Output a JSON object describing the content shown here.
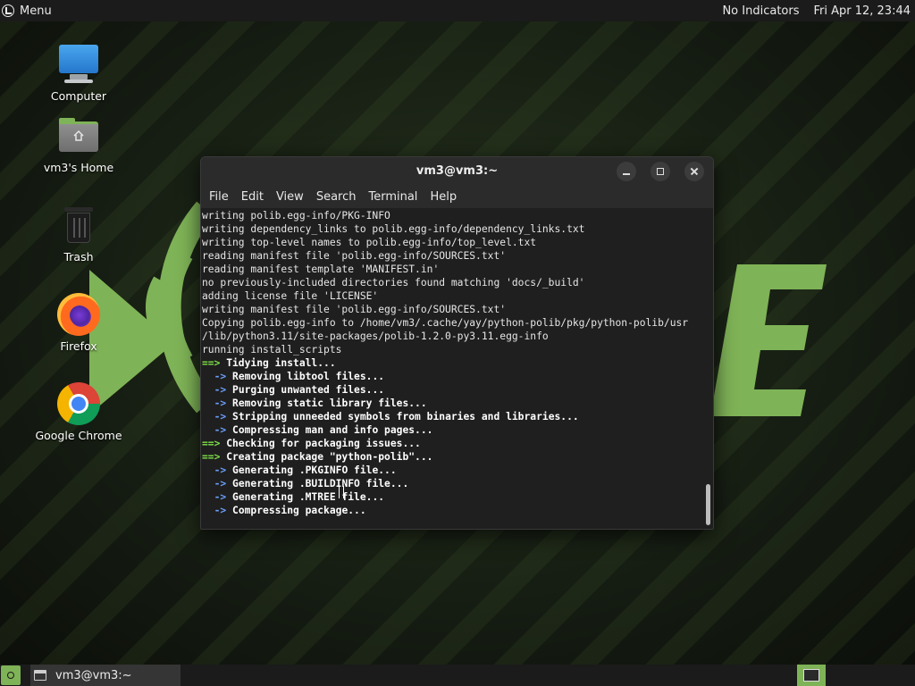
{
  "top_panel": {
    "menu_label": "Menu",
    "indicators": "No Indicators",
    "clock": "Fri Apr 12, 23:44"
  },
  "desktop": {
    "icons": [
      {
        "label": "Computer",
        "icon": "computer-icon"
      },
      {
        "label": "vm3's Home",
        "icon": "home-folder-icon"
      },
      {
        "label": "Trash",
        "icon": "trash-icon"
      },
      {
        "label": "Firefox",
        "icon": "firefox-icon"
      },
      {
        "label": "Google Chrome",
        "icon": "chrome-icon"
      }
    ]
  },
  "terminal": {
    "title": "vm3@vm3:~",
    "menu": [
      "File",
      "Edit",
      "View",
      "Search",
      "Terminal",
      "Help"
    ],
    "lines": [
      {
        "kind": "plain",
        "text": "writing polib.egg-info/PKG-INFO"
      },
      {
        "kind": "plain",
        "text": "writing dependency_links to polib.egg-info/dependency_links.txt"
      },
      {
        "kind": "plain",
        "text": "writing top-level names to polib.egg-info/top_level.txt"
      },
      {
        "kind": "plain",
        "text": "reading manifest file 'polib.egg-info/SOURCES.txt'"
      },
      {
        "kind": "plain",
        "text": "reading manifest template 'MANIFEST.in'"
      },
      {
        "kind": "plain",
        "text": "no previously-included directories found matching 'docs/_build'"
      },
      {
        "kind": "plain",
        "text": "adding license file 'LICENSE'"
      },
      {
        "kind": "plain",
        "text": "writing manifest file 'polib.egg-info/SOURCES.txt'"
      },
      {
        "kind": "plain",
        "text": "Copying polib.egg-info to /home/vm3/.cache/yay/python-polib/pkg/python-polib/usr"
      },
      {
        "kind": "plain",
        "text": "/lib/python3.11/site-packages/polib-1.2.0-py3.11.egg-info"
      },
      {
        "kind": "plain",
        "text": "running install_scripts"
      },
      {
        "kind": "main",
        "prefix": "==>",
        "text": " Tidying install..."
      },
      {
        "kind": "sub",
        "prefix": "  ->",
        "text": " Removing libtool files..."
      },
      {
        "kind": "sub",
        "prefix": "  ->",
        "text": " Purging unwanted files..."
      },
      {
        "kind": "sub",
        "prefix": "  ->",
        "text": " Removing static library files..."
      },
      {
        "kind": "sub",
        "prefix": "  ->",
        "text": " Stripping unneeded symbols from binaries and libraries..."
      },
      {
        "kind": "sub",
        "prefix": "  ->",
        "text": " Compressing man and info pages..."
      },
      {
        "kind": "main",
        "prefix": "==>",
        "text": " Checking for packaging issues..."
      },
      {
        "kind": "main",
        "prefix": "==>",
        "text": " Creating package \"python-polib\"..."
      },
      {
        "kind": "sub",
        "prefix": "  ->",
        "text": " Generating .PKGINFO file..."
      },
      {
        "kind": "sub",
        "prefix": "  ->",
        "text": " Generating .BUILDINFO file..."
      },
      {
        "kind": "sub",
        "prefix": "  ->",
        "text": " Generating .MTREE file..."
      },
      {
        "kind": "sub",
        "prefix": "  ->",
        "text": " Compressing package..."
      }
    ]
  },
  "taskbar": {
    "window_label": "vm3@vm3:~"
  },
  "colors": {
    "accent": "#7fb357",
    "prompt_main": "#7fe04a",
    "prompt_sub": "#6aa0ff"
  }
}
